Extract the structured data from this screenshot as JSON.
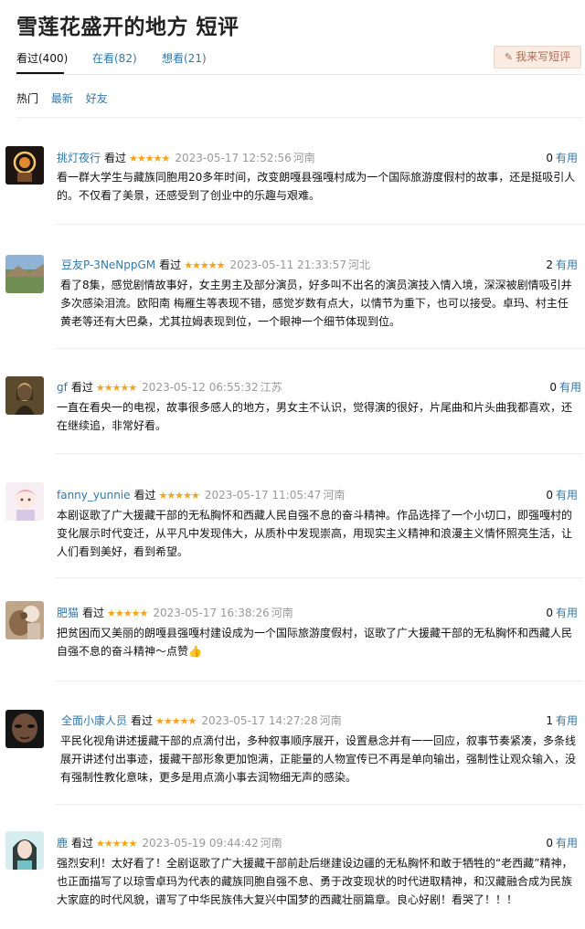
{
  "page_title": "雪莲花盛开的地方 短评",
  "tabs": [
    {
      "label": "看过(400)"
    },
    {
      "label": "在看(82)"
    },
    {
      "label": "想看(21)"
    }
  ],
  "write_button": {
    "icon": "pencil-icon",
    "label": "我来写短评"
  },
  "subtabs": [
    {
      "label": "热门"
    },
    {
      "label": "最新"
    },
    {
      "label": "好友"
    }
  ],
  "rating_icon": "five-star-rating",
  "colors": {
    "link": "#3377aa",
    "star": "#f4a31c",
    "write_button_bg": "#fbece3",
    "write_button_text": "#b06c52"
  },
  "reviews": [
    {
      "user": "挑灯夜行",
      "status": "看过",
      "stars": "★★★★★",
      "time": "2023-05-17 12:52:56",
      "location": "河南",
      "votes": "0",
      "useful_label": "有用",
      "content": "看一群大学生与藏族同胞用20多年时间，改变朗嘎县强嘎村成为一个国际旅游度假村的故事，还是挺吸引人的。不仅看了美景，还感受到了创业中的乐趣与艰难。"
    },
    {
      "user": "豆友P-3NeNppGM",
      "status": "看过",
      "stars": "★★★★★",
      "time": "2023-05-11 21:33:57",
      "location": "河北",
      "votes": "2",
      "useful_label": "有用",
      "content": "看了8集，感觉剧情故事好，女主男主及部分演员，好多叫不出名的演员演技入情入境，深深被剧情吸引并多次感染泪流。欧阳南 梅雁生等表现不错，感觉岁数有点大，以情节为重下，也可以接受。卓玛、村主任 黄老等还有大巴桑，尤其拉姆表现到位，一个眼神一个细节体现到位。"
    },
    {
      "user": "gf",
      "status": "看过",
      "stars": "★★★★★",
      "time": "2023-05-12 06:55:32",
      "location": "江苏",
      "votes": "0",
      "useful_label": "有用",
      "content": "一直在看央一的电视，故事很多感人的地方，男女主不认识，觉得演的很好，片尾曲和片头曲我都喜欢，还在继续追，非常好看。"
    },
    {
      "user": "fanny_yunnie",
      "status": "看过",
      "stars": "★★★★★",
      "time": "2023-05-17 11:05:47",
      "location": "河南",
      "votes": "0",
      "useful_label": "有用",
      "content": "本剧讴歌了广大援藏干部的无私胸怀和西藏人民自强不息的奋斗精神。作品选择了一个小切口，即强嘎村的变化展示时代变迁，从平凡中发现伟大，从质朴中发现崇高，用现实主义精神和浪漫主义情怀照亮生活，让人们看到美好，看到希望。"
    },
    {
      "user": "肥猫",
      "status": "看过",
      "stars": "★★★★★",
      "time": "2023-05-17 16:38:26",
      "location": "河南",
      "votes": "0",
      "useful_label": "有用",
      "content": "把贫困而又美丽的朗嘎县强嘎村建设成为一个国际旅游度假村，讴歌了广大援藏干部的无私胸怀和西藏人民自强不息的奋斗精神～点赞👍"
    },
    {
      "user": "全面小康人员",
      "status": "看过",
      "stars": "★★★★★",
      "time": "2023-05-17 14:27:28",
      "location": "河南",
      "votes": "1",
      "useful_label": "有用",
      "content": "平民化视角讲述援藏干部的点滴付出，多种叙事顺序展开，设置悬念并有一一回应，叙事节奏紧凑，多条线展开讲述付出事迹，援藏干部形象更加饱满，正能量的人物宣传已不再是单向输出，强制性让观众输入，没有强制性教化意味，更多是用点滴小事去润物细无声的感染。"
    },
    {
      "user": "鹿",
      "status": "看过",
      "stars": "★★★★★",
      "time": "2023-05-19 09:44:42",
      "location": "河南",
      "votes": "0",
      "useful_label": "有用",
      "content": "强烈安利！太好看了！全剧讴歌了广大援藏干部前赴后继建设边疆的无私胸怀和敢于牺牲的“老西藏”精神，也正面描写了以琼雪卓玛为代表的藏族同胞自强不息、勇于改变现状的时代进取精神，和汉藏融合成为民族大家庭的时代风貌，谱写了中华民族伟大复兴中国梦的西藏壮丽篇章。良心好剧！看哭了！！！"
    }
  ]
}
